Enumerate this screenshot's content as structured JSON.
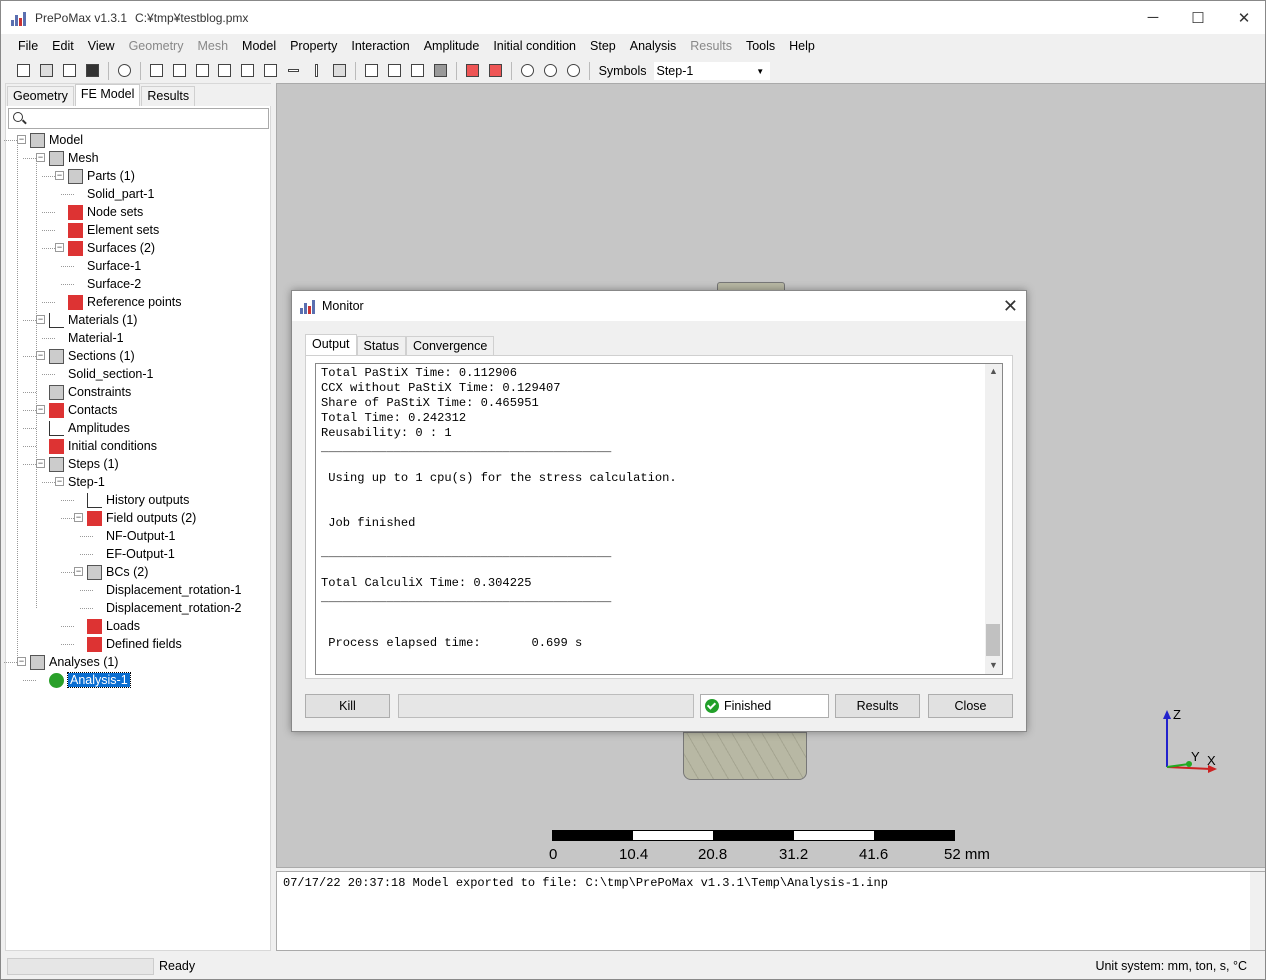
{
  "window": {
    "title": "PrePoMax v1.3.1",
    "file_path": "C:¥tmp¥testblog.pmx",
    "controls": {
      "minimize": "─",
      "maximize": "☐",
      "close": "✕"
    }
  },
  "menu": [
    "File",
    "Edit",
    "View",
    "Geometry",
    "Mesh",
    "Model",
    "Property",
    "Interaction",
    "Amplitude",
    "Initial condition",
    "Step",
    "Analysis",
    "Results",
    "Tools",
    "Help"
  ],
  "menu_disabled": [
    "Geometry",
    "Mesh",
    "Results"
  ],
  "toolbar": {
    "symbols_label": "Symbols",
    "step_select": "Step-1"
  },
  "left_tabs": [
    "Geometry",
    "FE Model",
    "Results"
  ],
  "left_active_tab": "FE Model",
  "tree": [
    {
      "label": "Model",
      "level": 0
    },
    {
      "label": "Mesh",
      "level": 1
    },
    {
      "label": "Parts (1)",
      "level": 2
    },
    {
      "label": "Solid_part-1",
      "level": 3
    },
    {
      "label": "Node sets",
      "level": 2
    },
    {
      "label": "Element sets",
      "level": 2
    },
    {
      "label": "Surfaces (2)",
      "level": 2
    },
    {
      "label": "Surface-1",
      "level": 3
    },
    {
      "label": "Surface-2",
      "level": 3
    },
    {
      "label": "Reference points",
      "level": 2
    },
    {
      "label": "Materials (1)",
      "level": 1
    },
    {
      "label": "Material-1",
      "level": 2
    },
    {
      "label": "Sections (1)",
      "level": 1
    },
    {
      "label": "Solid_section-1",
      "level": 2
    },
    {
      "label": "Constraints",
      "level": 1
    },
    {
      "label": "Contacts",
      "level": 1
    },
    {
      "label": "Amplitudes",
      "level": 1
    },
    {
      "label": "Initial conditions",
      "level": 1
    },
    {
      "label": "Steps (1)",
      "level": 1
    },
    {
      "label": "Step-1",
      "level": 2
    },
    {
      "label": "History outputs",
      "level": 3
    },
    {
      "label": "Field outputs (2)",
      "level": 3
    },
    {
      "label": "NF-Output-1",
      "level": 4
    },
    {
      "label": "EF-Output-1",
      "level": 4
    },
    {
      "label": "BCs (2)",
      "level": 3
    },
    {
      "label": "Displacement_rotation-1",
      "level": 4
    },
    {
      "label": "Displacement_rotation-2",
      "level": 4
    },
    {
      "label": "Loads",
      "level": 3
    },
    {
      "label": "Defined fields",
      "level": 3
    },
    {
      "label": "Analyses (1)",
      "level": 0
    },
    {
      "label": "Analysis-1",
      "level": 1,
      "selected": true
    }
  ],
  "monitor": {
    "title": "Monitor",
    "tabs": [
      "Output",
      "Status",
      "Convergence"
    ],
    "output_lines": [
      "Total PaStiX Time: 0.112906",
      "CCX without PaStiX Time: 0.129407",
      "Share of PaStiX Time: 0.465951",
      "Total Time: 0.242312",
      "Reusability: 0 : 1",
      "________________________________________",
      "",
      " Using up to 1 cpu(s) for the stress calculation.",
      "",
      "",
      " Job finished",
      "",
      "________________________________________",
      "",
      "Total CalculiX Time: 0.304225",
      "________________________________________",
      "",
      "",
      " Process elapsed time:       0.699 s"
    ],
    "buttons": {
      "kill": "Kill",
      "status": "Finished",
      "results": "Results",
      "close": "Close"
    }
  },
  "scale": {
    "ticks": [
      "0",
      "10.4",
      "20.8",
      "31.2",
      "41.6",
      "52 mm"
    ]
  },
  "axes": {
    "z": "Z",
    "y": "Y",
    "x": "X"
  },
  "console": {
    "line": "07/17/22 20:37:18   Model exported to file: C:\\tmp\\PrePoMax v1.3.1\\Temp\\Analysis-1.inp"
  },
  "status": {
    "text": "Ready",
    "units": "Unit system: mm, ton, s, °C"
  }
}
